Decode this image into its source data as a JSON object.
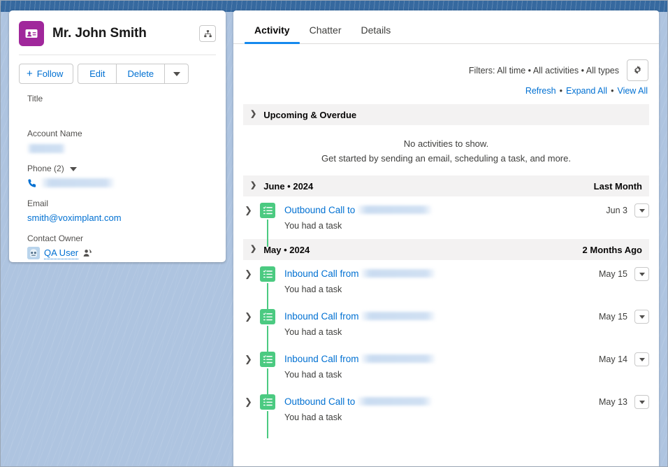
{
  "contact_card": {
    "avatar_icon": "contact-card-icon",
    "avatar_color": "#a0279b",
    "name": "Mr. John Smith",
    "hierarchy_icon": "org-hierarchy-icon",
    "actions": {
      "follow_label": "Follow",
      "follow_icon": "plus-icon",
      "edit_label": "Edit",
      "delete_label": "Delete",
      "more_icon": "chevron-down-icon"
    },
    "fields": [
      {
        "label": "Title",
        "value": ""
      },
      {
        "label": "Account Name",
        "value": "",
        "redacted": true
      },
      {
        "label": "Phone (2)",
        "value": "",
        "redacted": true,
        "icon": "phone-icon"
      },
      {
        "label": "Email",
        "value": "smith@voximplant.com",
        "link": true
      },
      {
        "label": "Contact Owner",
        "value": "QA User",
        "link": true,
        "icon": "user-avatar"
      }
    ],
    "field_labels": {
      "title": "Title",
      "account_name": "Account Name",
      "phone": "Phone (2)",
      "email": "Email",
      "contact_owner": "Contact Owner"
    },
    "field_values": {
      "email": "smith@voximplant.com",
      "owner": "QA User"
    }
  },
  "activity_panel": {
    "tabs": [
      {
        "label": "Activity",
        "active": true
      },
      {
        "label": "Chatter",
        "active": false
      },
      {
        "label": "Details",
        "active": false
      }
    ],
    "filters_text": "Filters: All time • All activities • All types",
    "filter_settings_icon": "gear-icon",
    "links": {
      "refresh": "Refresh",
      "expand_all": "Expand All",
      "view_all": "View All",
      "separator": "•"
    },
    "sections": [
      {
        "title": "Upcoming & Overdue",
        "right_label": "",
        "empty_line1": "No activities to show.",
        "empty_line2": "Get started by sending an email, scheduling a task, and more.",
        "items": []
      },
      {
        "title": "June • 2024",
        "right_label": "Last Month",
        "items": [
          {
            "title": "Outbound Call to",
            "subtitle": "You had a task",
            "date": "Jun 3",
            "icon": "task-icon",
            "redacted_target": true
          }
        ]
      },
      {
        "title": "May • 2024",
        "right_label": "2 Months Ago",
        "items": [
          {
            "title": "Inbound Call from",
            "subtitle": "You had a task",
            "date": "May 15",
            "icon": "task-icon",
            "redacted_target": true
          },
          {
            "title": "Inbound Call from",
            "subtitle": "You had a task",
            "date": "May 15",
            "icon": "task-icon",
            "redacted_target": true
          },
          {
            "title": "Inbound Call from",
            "subtitle": "You had a task",
            "date": "May 14",
            "icon": "task-icon",
            "redacted_target": true
          },
          {
            "title": "Outbound Call to",
            "subtitle": "You had a task",
            "date": "May 13",
            "icon": "task-icon",
            "redacted_target": true
          }
        ]
      }
    ]
  },
  "colors": {
    "link": "#0070d2",
    "tab_active_underline": "#1589ee",
    "task_green": "#4bca81",
    "contact_purple": "#a0279b",
    "section_header_bg": "#f3f2f2",
    "page_background": "#aec4e0"
  }
}
